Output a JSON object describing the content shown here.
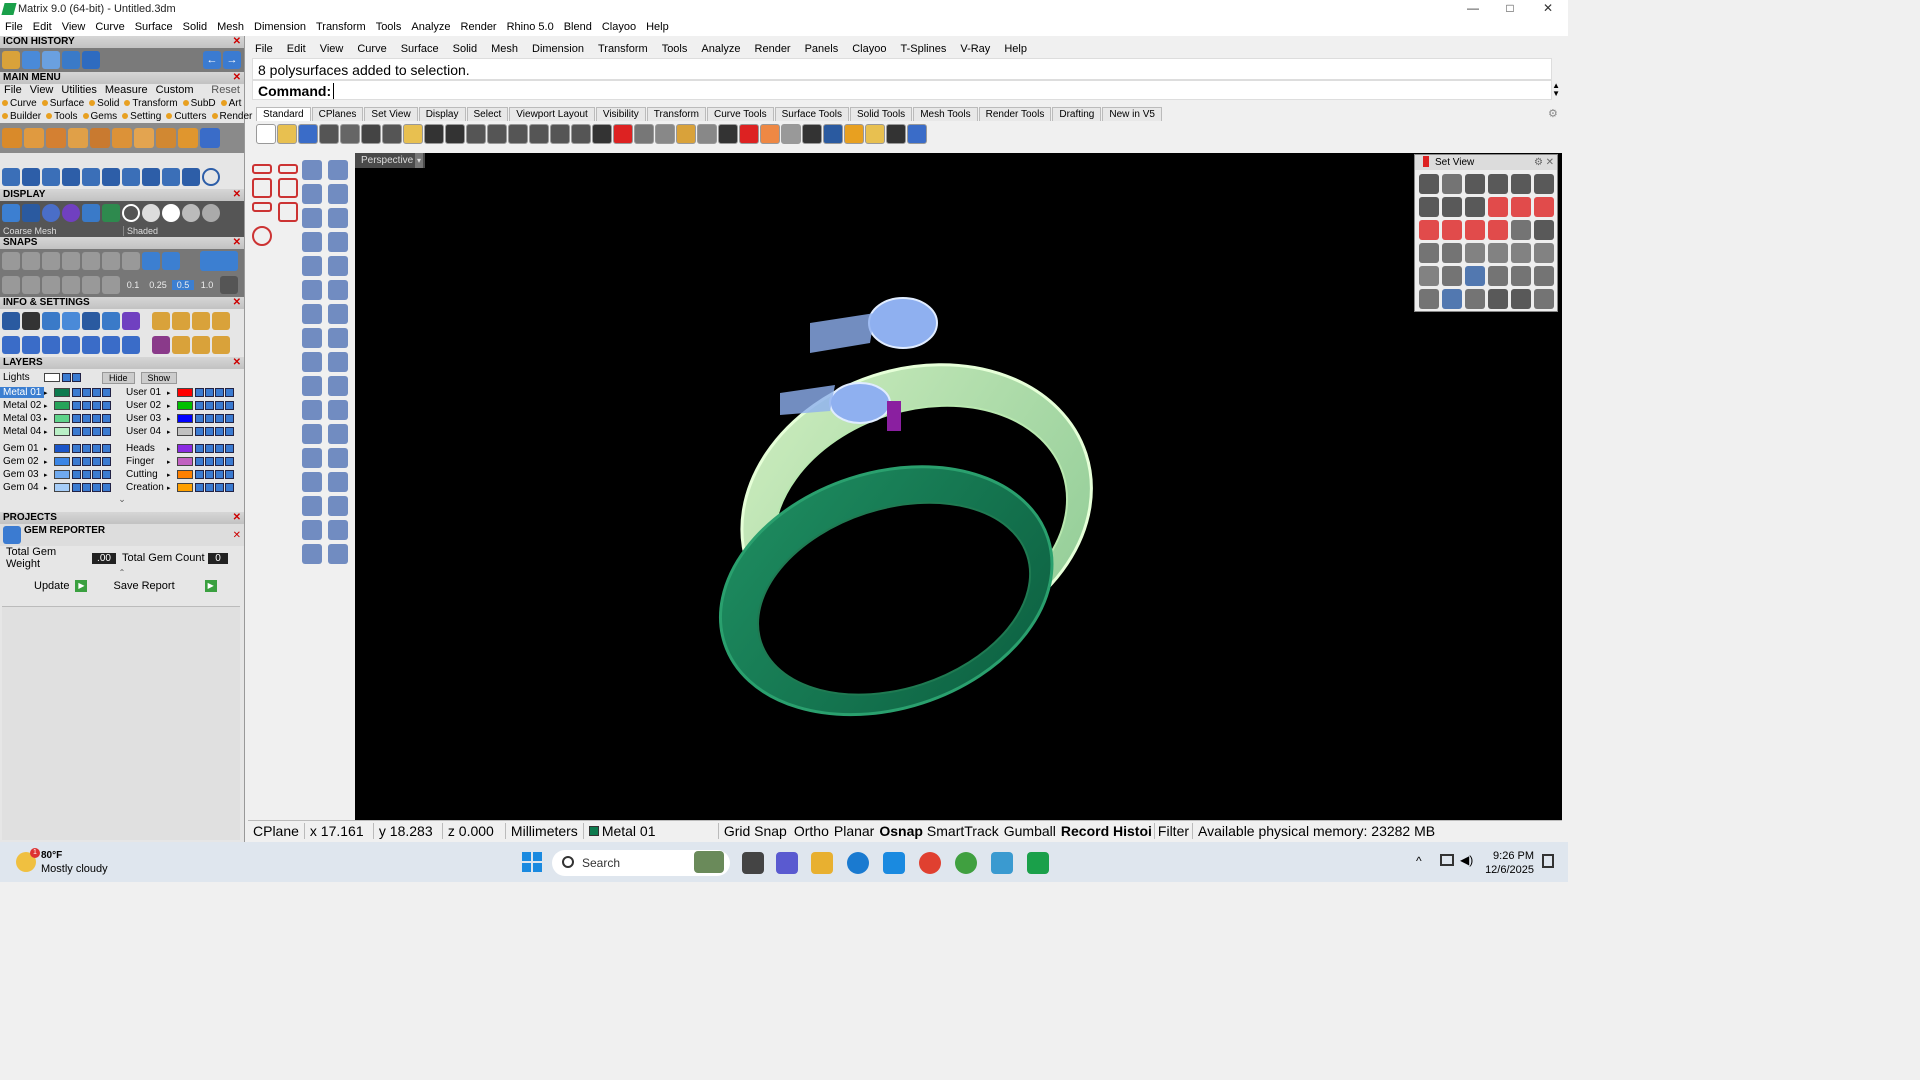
{
  "window": {
    "title": "Matrix 9.0 (64-bit) - Untitled.3dm",
    "minimize": "—",
    "maximize": "□",
    "close": "✕"
  },
  "top_menu": [
    "File",
    "Edit",
    "View",
    "Curve",
    "Surface",
    "Solid",
    "Mesh",
    "Dimension",
    "Transform",
    "Tools",
    "Analyze",
    "Render",
    "Rhino 5.0",
    "Blend",
    "Clayoo",
    "Help"
  ],
  "left": {
    "icon_history": "ICON HISTORY",
    "main_menu": "MAIN MENU",
    "main_menu_items": [
      "File",
      "View",
      "Utilities",
      "Measure",
      "Custom"
    ],
    "reset": "Reset",
    "mm_row1": [
      "Curve",
      "Surface",
      "Solid",
      "Transform",
      "SubD",
      "Art"
    ],
    "mm_row2": [
      "Builder",
      "Tools",
      "Gems",
      "Setting",
      "Cutters",
      "Render"
    ],
    "display": "DISPLAY",
    "display_mesh": "Coarse Mesh",
    "display_mode": "Shaded",
    "snaps": "SNAPS",
    "snap_values": [
      "0.1",
      "0.25",
      "0.5",
      "1.0"
    ],
    "info": "INFO & SETTINGS",
    "layers": "LAYERS",
    "lights": "Lights",
    "hide": "Hide",
    "show": "Show",
    "layers_left": [
      {
        "name": "Metal 01",
        "color": "#0d7a4e",
        "selected": true
      },
      {
        "name": "Metal 02",
        "color": "#27a35a"
      },
      {
        "name": "Metal 03",
        "color": "#5ed38a"
      },
      {
        "name": "Metal 04",
        "color": "#b9f0c6"
      },
      {
        "name": "Gem 01",
        "color": "#1a55c8"
      },
      {
        "name": "Gem 02",
        "color": "#3b86e6"
      },
      {
        "name": "Gem 03",
        "color": "#6faaf0"
      },
      {
        "name": "Gem 04",
        "color": "#a6cdf8"
      }
    ],
    "layers_right": [
      {
        "name": "User 01",
        "color": "#ff0000"
      },
      {
        "name": "User 02",
        "color": "#00c000"
      },
      {
        "name": "User 03",
        "color": "#0000ff"
      },
      {
        "name": "User 04",
        "color": "#c0c0c0"
      },
      {
        "name": "Heads",
        "color": "#8a2be2"
      },
      {
        "name": "Finger",
        "color": "#c060c0"
      },
      {
        "name": "Cutting",
        "color": "#ff8000"
      },
      {
        "name": "Creation",
        "color": "#ffa000"
      }
    ],
    "projects": "PROJECTS",
    "gem_reporter": "GEM REPORTER",
    "total_gem_weight_label": "Total Gem Weight",
    "total_gem_weight": ".00",
    "total_gem_count_label": "Total Gem Count",
    "total_gem_count": "0",
    "update": "Update",
    "save_report": "Save Report"
  },
  "right_menu": [
    "File",
    "Edit",
    "View",
    "Curve",
    "Surface",
    "Solid",
    "Mesh",
    "Dimension",
    "Transform",
    "Tools",
    "Analyze",
    "Render",
    "Panels",
    "Clayoo",
    "T-Splines",
    "V-Ray",
    "Help"
  ],
  "command": {
    "history": "8 polysurfaces added to selection.",
    "prompt": "Command:",
    "value": ""
  },
  "tabs": [
    "Standard",
    "CPlanes",
    "Set View",
    "Display",
    "Select",
    "Viewport Layout",
    "Visibility",
    "Transform",
    "Curve Tools",
    "Surface Tools",
    "Solid Tools",
    "Mesh Tools",
    "Render Tools",
    "Drafting",
    "New in V5"
  ],
  "viewport": {
    "name": "Perspective"
  },
  "setview": {
    "title": "Set View"
  },
  "status": {
    "cplane": "CPlane",
    "x": "x 17.161",
    "y": "y 18.283",
    "z": "z 0.000",
    "units": "Millimeters",
    "layer": "Metal 01",
    "layer_color": "#0d7a4e",
    "grid_snap": "Grid Snap",
    "ortho": "Ortho",
    "planar": "Planar",
    "osnap": "Osnap",
    "smarttrack": "SmartTrack",
    "gumball": "Gumball",
    "record": "Record Histoi",
    "filter": "Filter",
    "memory": "Available physical memory: 23282 MB"
  },
  "taskbar": {
    "temp": "80°F",
    "weather": "Mostly cloudy",
    "badge": "1",
    "search": "Search",
    "time": "9:26 PM",
    "date": "12/6/2025"
  }
}
